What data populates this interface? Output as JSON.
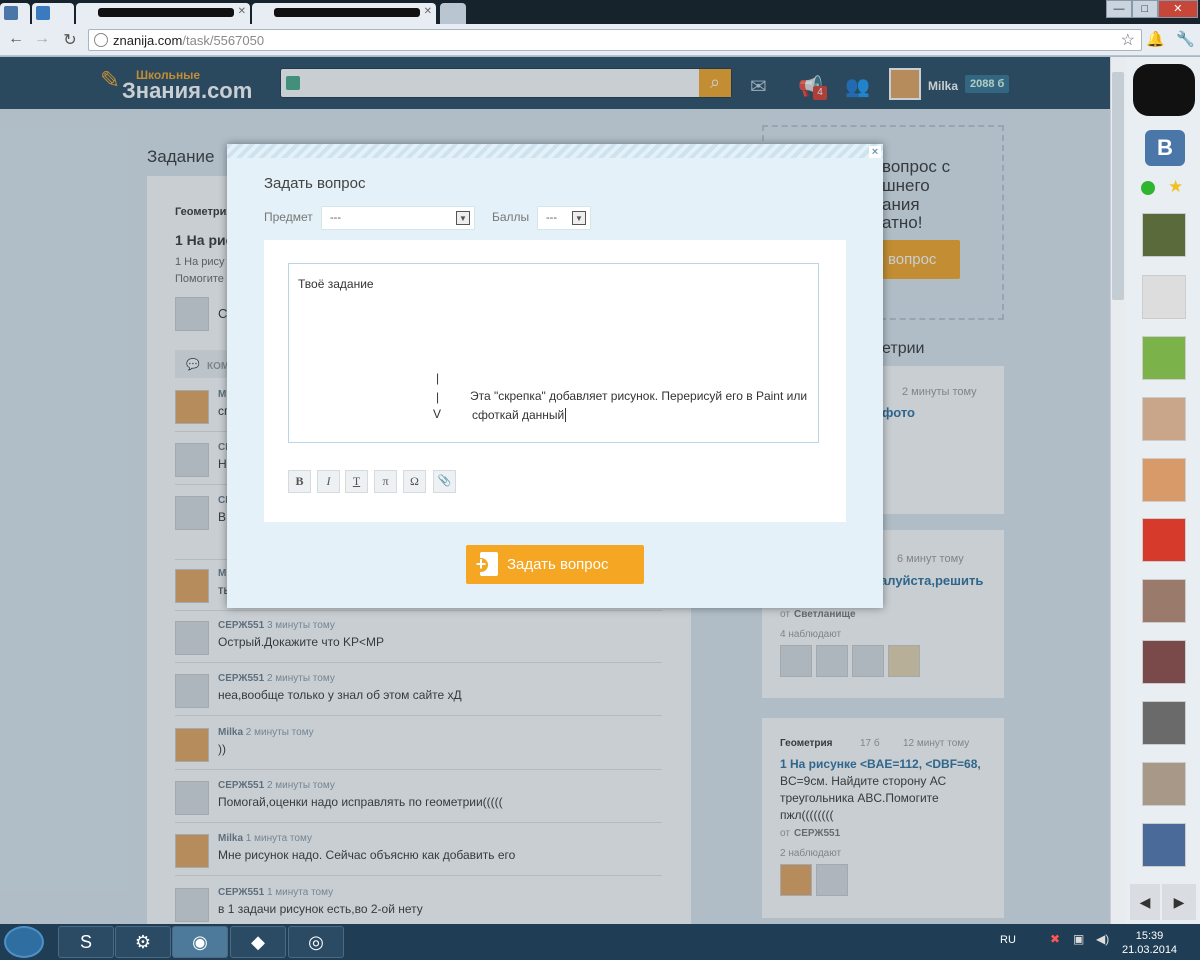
{
  "browser": {
    "tabs": [
      {
        "label": ""
      },
      {
        "label": ""
      },
      {
        "label": ""
      }
    ],
    "url_host": "znanija.com",
    "url_path": "/task/5567050",
    "win_min": "—",
    "win_max": "□",
    "win_close": "✕"
  },
  "site": {
    "logo_top": "Школьные",
    "logo_bottom": "Знания.com",
    "notif_count": "4",
    "username": "Milka",
    "points": "2088 б"
  },
  "page": {
    "title": "Задание",
    "subject": "Геометрия",
    "task_title": "1 На рису",
    "task_text1": "1 На рису",
    "task_text2": "Помогите",
    "comments_label": "КОМ",
    "comments": [
      {
        "author": "Milka",
        "time": "",
        "text": "сп"
      },
      {
        "author": "СЕРЖ551",
        "time": "",
        "text": "Н"
      },
      {
        "author": "СЕРЖ551",
        "time": "",
        "text": "В"
      },
      {
        "author": "Milka",
        "time": "",
        "text": "ты"
      },
      {
        "author": "СЕРЖ551",
        "time": "3 минуты тому",
        "text": "Острый.Докажите что KP<MP"
      },
      {
        "author": "СЕРЖ551",
        "time": "2 минуты тому",
        "text": "неа,вообще только у знал об этом сайте хД"
      },
      {
        "author": "Milka",
        "time": "2 минуты тому",
        "text": "))"
      },
      {
        "author": "СЕРЖ551",
        "time": "2 минуты тому",
        "text": "Помогай,оценки надо исправлять по геометрии((((("
      },
      {
        "author": "Milka",
        "time": "1 минута тому",
        "text": "Мне рисунок надо. Сейчас объясню как добавить его"
      },
      {
        "author": "СЕРЖ551",
        "time": "1 минута тому",
        "text": "в 1 задачи рисунок есть,во 2-ой нету"
      }
    ]
  },
  "sidebar": {
    "promo_line1": "вопрос с",
    "promo_line2": "шнего",
    "promo_line3": "ания",
    "promo_line4": "атно!",
    "promo_btn": "ь вопрос",
    "section_title": "етрии",
    "card1_time": "2 минуты тому",
    "card1_link": "фото",
    "card2_time": "6 минут тому",
    "card2_link": "алуйста,решить",
    "card2_from_label": "от",
    "card2_from": "Светланище",
    "card2_watch": "4 наблюдают",
    "card3_subject": "Геометрия",
    "card3_pts": "17 б",
    "card3_time": "12 минут тому",
    "card3_title": "1 На рисунке <BAE=112, <DBF=68,",
    "card3_line2": "BC=9см. Найдите сторону АС",
    "card3_line3": "треугольника ABC.Помогите",
    "card3_line4": "пжл((((((((",
    "card3_from_label": "от",
    "card3_from": "СЕРЖ551",
    "card3_watch": "2 наблюдают"
  },
  "modal": {
    "close": "×",
    "title": "Задать вопрос",
    "subject_label": "Предмет",
    "subject_value": "---",
    "points_label": "Баллы",
    "points_value": "---",
    "placeholder": "Твоё задание",
    "arrow1": "|",
    "arrow2": "|",
    "arrow3": "V",
    "text_line1": "Эта \"скрепка\" добавляет рисунок. Перерисуй его в Paint или",
    "text_line2": "сфоткай данный",
    "fmt_bold": "B",
    "fmt_italic": "I",
    "fmt_strike": "T",
    "fmt_pi": "π",
    "fmt_omega": "Ω",
    "fmt_clip": "📎",
    "submit": "Задать вопрос"
  },
  "taskbar": {
    "lang": "RU",
    "time": "15:39",
    "date": "21.03.2014"
  }
}
